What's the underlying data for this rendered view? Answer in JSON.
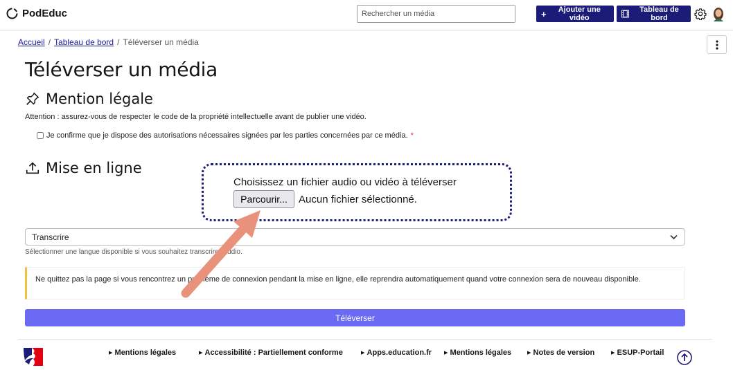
{
  "header": {
    "brand": "PodEduc",
    "search_placeholder": "Rechercher un média",
    "add_video": "Ajouter une vidéo",
    "dashboard": "Tableau de bord"
  },
  "breadcrumb": {
    "home": "Accueil",
    "dashboard": "Tableau de bord",
    "current": "Téléverser un média",
    "sep1": "/",
    "sep2": "/"
  },
  "page": {
    "title": "Téléverser un média",
    "legal_title": "Mention légale",
    "attention": "Attention : assurez-vous de respecter le code de la propriété intellectuelle avant de publier une vidéo.",
    "confirm": "Je confirme que je dispose des autorisations nécessaires signées par les parties concernées par ce média.",
    "required_mark": "*",
    "upload_title": "Mise en ligne",
    "file_label": "Choisissez un fichier audio ou vidéo à téléverser",
    "file_button": "Parcourir...",
    "file_status": "Aucun fichier sélectionné.",
    "transcribe_value": "Transcrire",
    "transcribe_help": "Sélectionner une langue disponible si vous souhaitez transcrire l'audio.",
    "alert": "Ne quittez pas la page si vous rencontrez un problème de connexion pendant la mise en ligne, elle reprendra automatiquement quand votre connexion sera de nouveau disponible.",
    "submit": "Téléverser"
  },
  "footer": {
    "links": [
      "Mentions légales",
      "Accessibilité : Partiellement conforme",
      "Apps.education.fr",
      "Mentions légales",
      "Notes de version",
      "ESUP-Portail"
    ]
  },
  "colors": {
    "primary": "#1b1b78",
    "submit": "#6a6af4",
    "alert_border": "#f0c23b",
    "annotation_arrow": "#e8917b"
  }
}
